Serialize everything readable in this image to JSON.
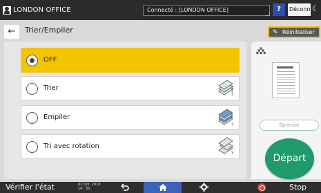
{
  "topbar": {
    "user_label": "LONDON OFFICE",
    "connection_text": "Connecté : [LONDON OFFICE]",
    "help_label": "?",
    "logout_label": "Déconnexion"
  },
  "header": {
    "title": "Trier/Empiler",
    "reset_label": "Réinitialiser"
  },
  "options": [
    {
      "label": "OFF",
      "selected": true,
      "icon": "none"
    },
    {
      "label": "Trier",
      "selected": false,
      "icon": "sort-stack-icon"
    },
    {
      "label": "Empiler",
      "selected": false,
      "icon": "stack-icon"
    },
    {
      "label": "Tri avec rotation",
      "selected": false,
      "icon": "rotate-sort-icon"
    }
  ],
  "right_panel": {
    "proof_label": "Épreuve",
    "start_label": "Départ"
  },
  "bottombar": {
    "status_label": "Vérifier l'état",
    "date": "02 Oct. 2018",
    "time": "14 : 55",
    "stop_label": "Stop"
  },
  "colors": {
    "selected_option": "#f5c400",
    "start_button": "#1f9a6c",
    "home_tab": "#3b64b8",
    "reset_border": "#f1c400",
    "stop_icon": "#e03c2e"
  }
}
